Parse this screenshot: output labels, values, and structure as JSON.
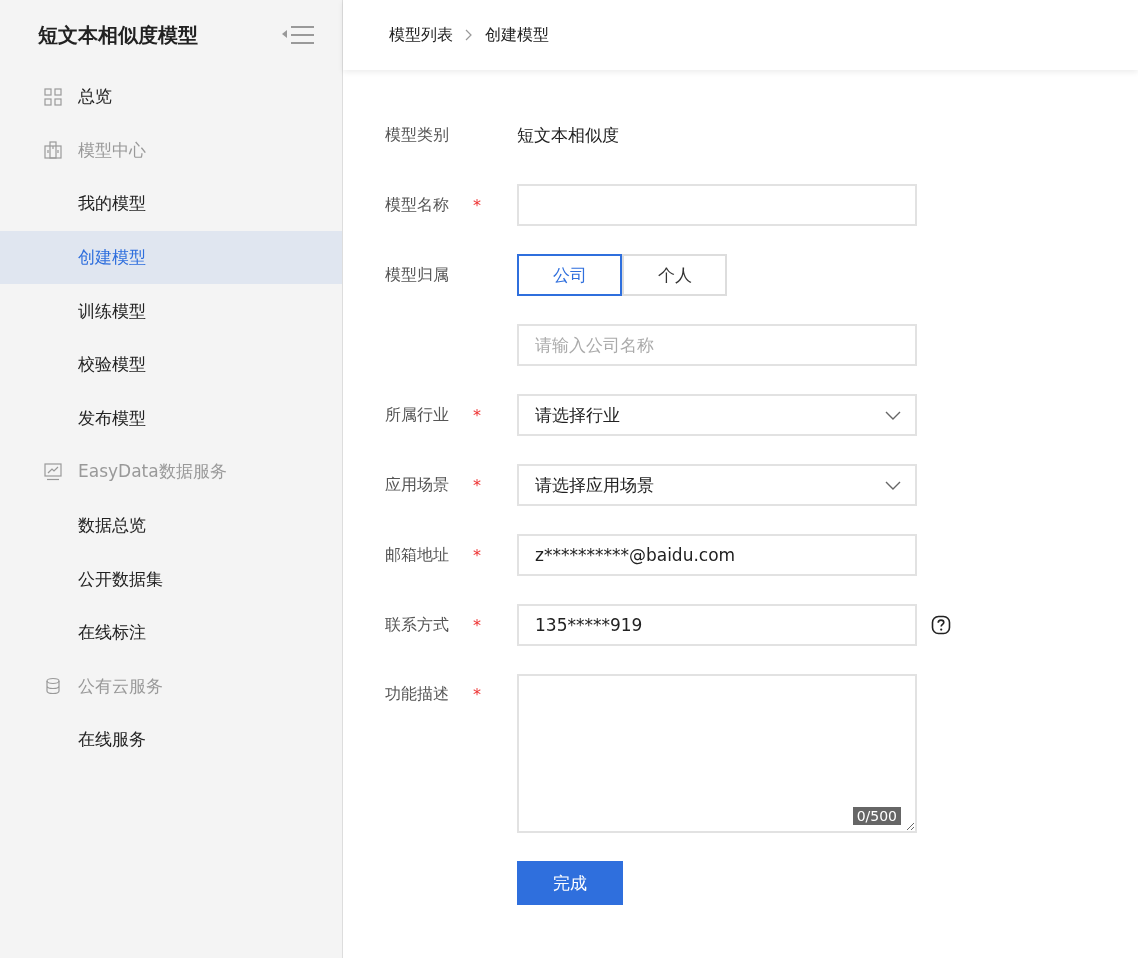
{
  "sidebar": {
    "title": "短文本相似度模型",
    "items": [
      {
        "kind": "page",
        "label": "总览",
        "selected": false
      },
      {
        "kind": "group",
        "label": "模型中心"
      },
      {
        "kind": "link",
        "label": "我的模型",
        "selected": false
      },
      {
        "kind": "link",
        "label": "创建模型",
        "selected": true
      },
      {
        "kind": "link",
        "label": "训练模型",
        "selected": false
      },
      {
        "kind": "link",
        "label": "校验模型",
        "selected": false
      },
      {
        "kind": "link",
        "label": "发布模型",
        "selected": false
      },
      {
        "kind": "group",
        "label": "EasyData数据服务"
      },
      {
        "kind": "link",
        "label": "数据总览",
        "selected": false
      },
      {
        "kind": "link",
        "label": "公开数据集",
        "selected": false
      },
      {
        "kind": "link",
        "label": "在线标注",
        "selected": false
      },
      {
        "kind": "group",
        "label": "公有云服务"
      },
      {
        "kind": "link",
        "label": "在线服务",
        "selected": false
      }
    ]
  },
  "breadcrumb": [
    "模型列表",
    "创建模型"
  ],
  "form": {
    "rows": [
      {
        "kind": "static",
        "label": "模型类别",
        "value": "短文本相似度"
      },
      {
        "kind": "text",
        "label": "模型名称",
        "required_mark": "*"
      },
      {
        "kind": "toggle",
        "label": "模型归属",
        "options": [
          {
            "label": "公司",
            "selected": true
          },
          {
            "label": "个人",
            "selected": false
          }
        ]
      },
      {
        "kind": "text",
        "placeholder": "请输入公司名称"
      },
      {
        "kind": "select",
        "label": "所属行业",
        "required_mark": "*",
        "value": "请选择行业"
      },
      {
        "kind": "select",
        "label": "应用场景",
        "required_mark": "*",
        "value": "请选择应用场景"
      },
      {
        "kind": "text",
        "label": "邮箱地址",
        "required_mark": "*",
        "value": "z**********@baidu.com"
      },
      {
        "kind": "text",
        "label": "联系方式",
        "required_mark": "*",
        "value": "135*****919",
        "help": true
      },
      {
        "kind": "textarea",
        "label": "功能描述",
        "required_mark": "*",
        "counter": "0/500"
      }
    ],
    "submit": "完成"
  }
}
